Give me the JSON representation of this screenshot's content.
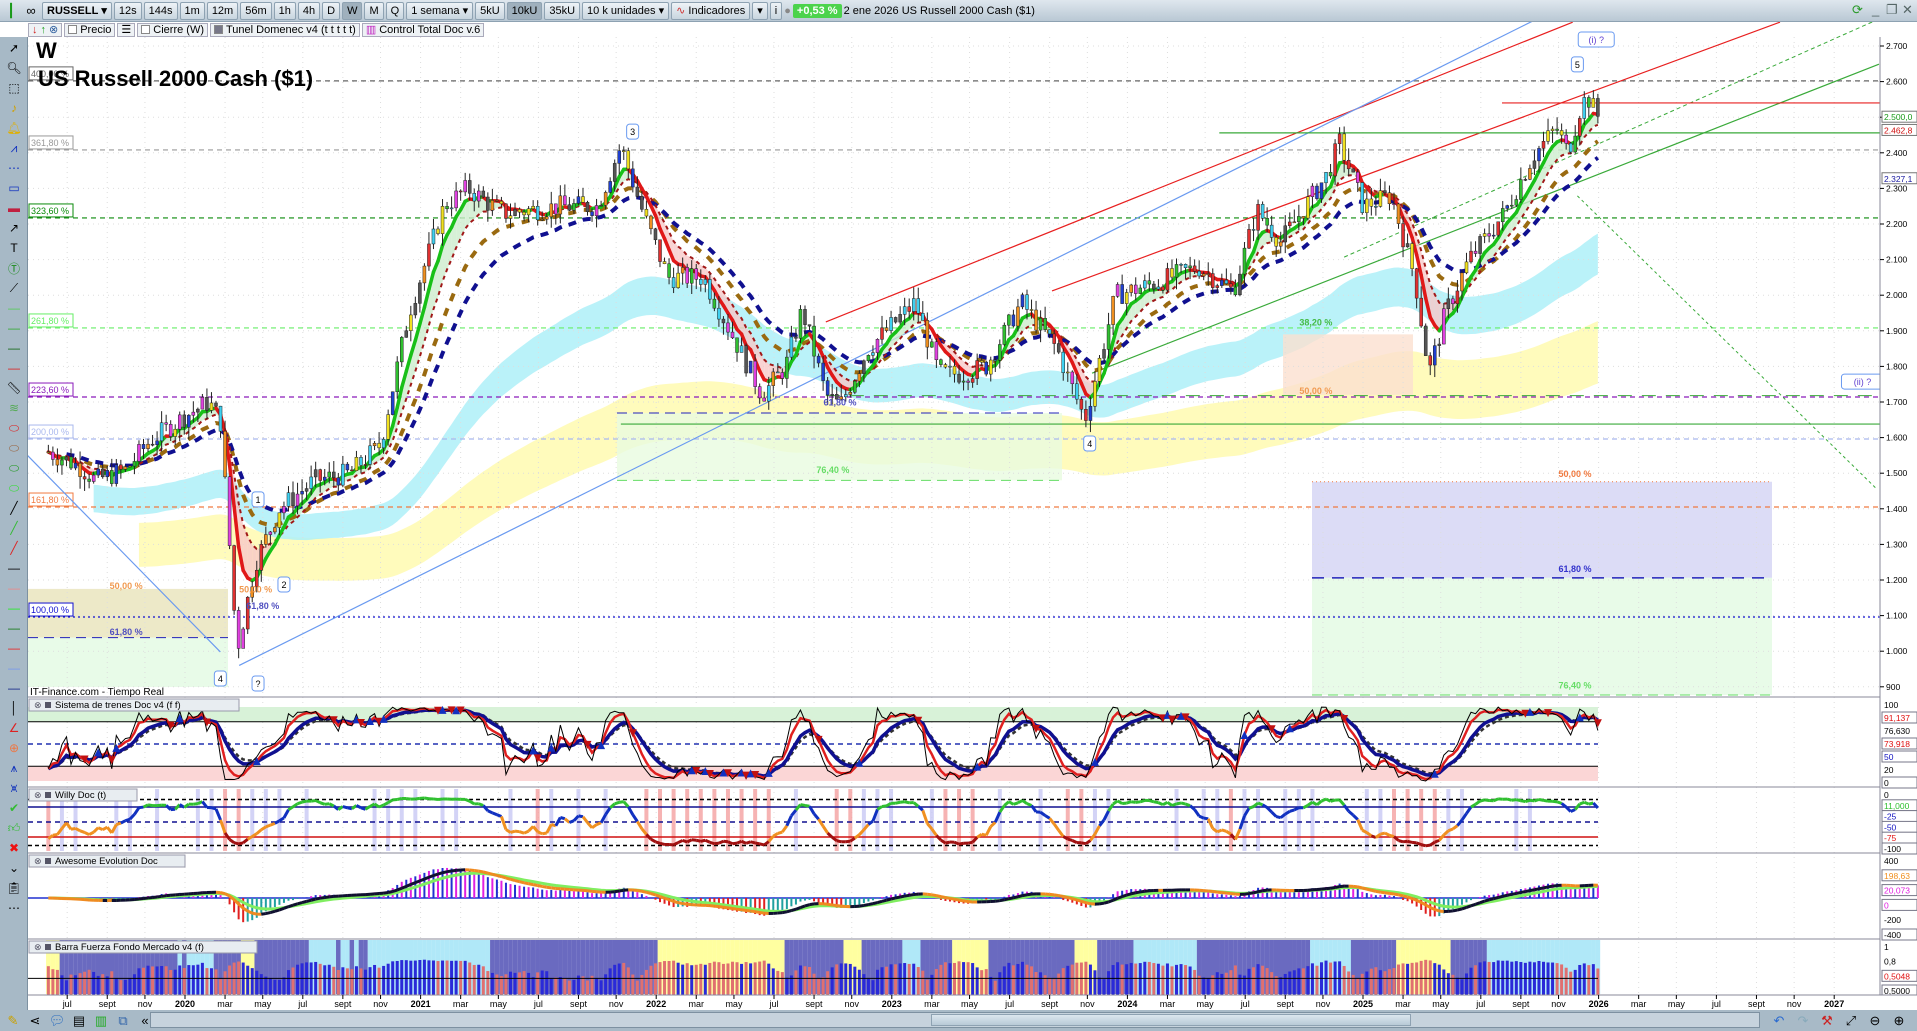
{
  "toolbar": {
    "symbol": "RUSSELL",
    "timeframes": [
      "12s",
      "144s",
      "1m",
      "12m",
      "56m",
      "1h",
      "4h",
      "D",
      "W",
      "M",
      "Q"
    ],
    "active_timeframe": "W",
    "period": "1 semana",
    "units": [
      "5kU",
      "10kU",
      "35kU"
    ],
    "active_unit": "10kU",
    "units_select": "10 k unidades",
    "indicators_label": "Indicadores",
    "change": "+0,53 %",
    "title_info": "2 ene 2026 US Russell 2000 Cash ($1)"
  },
  "legend": {
    "items": [
      "Precio",
      "Cierre (W)",
      "Tunel Domenec v4 (t t t t t)",
      "Control Total Doc v.6"
    ]
  },
  "chart": {
    "period_letter": "W",
    "title": "US Russell 2000 Cash ($1)",
    "source": "IT-Finance.com - Tiempo Real",
    "price_ticks": [
      "2.700",
      "2.600",
      "2.500",
      "2.400",
      "2.300",
      "2.200",
      "2.100",
      "2.000",
      "1.900",
      "1.800",
      "1.700",
      "1.600",
      "1.500",
      "1.400",
      "1.300",
      "1.200",
      "1.100",
      "1.000",
      "900"
    ],
    "price_tick_values": [
      2700,
      2600,
      2500,
      2400,
      2300,
      2200,
      2100,
      2000,
      1900,
      1800,
      1700,
      1600,
      1500,
      1400,
      1300,
      1200,
      1100,
      1000,
      900
    ],
    "price_markers": [
      {
        "label": "2.500,0",
        "price": 2500,
        "color": "#1a9a1a"
      },
      {
        "label": "2.462,8",
        "price": 2462.8,
        "color": "#d01010"
      },
      {
        "label": "2.327,1",
        "price": 2327.1,
        "color": "#1a1aa0"
      }
    ],
    "fib_levels": [
      {
        "label": "400,00 %",
        "price": 2602,
        "color": "#666666"
      },
      {
        "label": "361,80 %",
        "price": 2408,
        "color": "#999999"
      },
      {
        "label": "323,60 %",
        "price": 2217,
        "color": "#0a8a0a"
      },
      {
        "label": "261,80 %",
        "price": 1908,
        "color": "#66ee66"
      },
      {
        "label": "223,60 %",
        "price": 1714,
        "color": "#8a1aba"
      },
      {
        "label": "200,00 %",
        "price": 1596,
        "color": "#a9b8ee"
      },
      {
        "label": "161,80 %",
        "price": 1405,
        "color": "#f07a40"
      },
      {
        "label": "100,00 %",
        "price": 1096,
        "color": "#1010d0"
      }
    ],
    "retracement_labels": [
      {
        "label": "50,00 %",
        "t": 2019.75,
        "price": 1175,
        "color": "#f09a50"
      },
      {
        "label": "61,80 %",
        "t": 2019.75,
        "price": 1045,
        "color": "#5050c0"
      },
      {
        "label": "50,00 %",
        "t": 2020.3,
        "price": 1165,
        "color": "#f09a50"
      },
      {
        "label": "61,80 %",
        "t": 2020.33,
        "price": 1118,
        "color": "#5050c0"
      },
      {
        "label": "61,80 %",
        "t": 2022.78,
        "price": 1690,
        "color": "#5050c0"
      },
      {
        "label": "76,40 %",
        "t": 2022.75,
        "price": 1500,
        "color": "#66dd66"
      },
      {
        "label": "38,20 %",
        "t": 2024.8,
        "price": 1915,
        "color": "#44bb44"
      },
      {
        "label": "50,00 %",
        "t": 2024.8,
        "price": 1722,
        "color": "#f09a50"
      },
      {
        "label": "50,00 %",
        "t": 2025.9,
        "price": 1490,
        "color": "#f07a40"
      },
      {
        "label": "61,80 %",
        "t": 2025.9,
        "price": 1222,
        "color": "#3333cc"
      },
      {
        "label": "76,40 %",
        "t": 2025.9,
        "price": 895,
        "color": "#66dd66"
      }
    ],
    "wave_labels": [
      {
        "text": "1",
        "t": 2020.31,
        "price": 1425
      },
      {
        "text": "2",
        "t": 2020.42,
        "price": 1186
      },
      {
        "text": "3",
        "t": 2021.9,
        "price": 2458
      },
      {
        "text": "4",
        "t": 2020.15,
        "price": 922
      },
      {
        "text": "?",
        "t": 2020.31,
        "price": 908
      },
      {
        "text": "4",
        "t": 2023.84,
        "price": 1582
      },
      {
        "text": "5",
        "t": 2025.91,
        "price": 2647
      },
      {
        "text": "(i) ?",
        "t": 2025.99,
        "price": 2717
      },
      {
        "text": "(ii) ?",
        "t": 2027.12,
        "price": 1756
      }
    ],
    "date_labels": [
      "jul",
      "sept",
      "nov",
      "2020",
      "mar",
      "may",
      "jul",
      "sept",
      "nov",
      "2021",
      "mar",
      "may",
      "jul",
      "sept",
      "nov",
      "2022",
      "mar",
      "may",
      "jul",
      "sept",
      "nov",
      "2023",
      "mar",
      "may",
      "jul",
      "sept",
      "nov",
      "2024",
      "mar",
      "may",
      "jul",
      "sept",
      "nov",
      "2025",
      "mar",
      "may",
      "jul",
      "sept",
      "nov",
      "2026",
      "mar",
      "may",
      "jul",
      "sept",
      "nov",
      "2027"
    ],
    "date_label_times": [
      2019.5,
      2019.67,
      2019.83,
      2020,
      2020.17,
      2020.33,
      2020.5,
      2020.67,
      2020.83,
      2021,
      2021.17,
      2021.33,
      2021.5,
      2021.67,
      2021.83,
      2022,
      2022.17,
      2022.33,
      2022.5,
      2022.67,
      2022.83,
      2023,
      2023.17,
      2023.33,
      2023.5,
      2023.67,
      2023.83,
      2024,
      2024.17,
      2024.33,
      2024.5,
      2024.67,
      2024.83,
      2025,
      2025.17,
      2025.33,
      2025.5,
      2025.67,
      2025.83,
      2026,
      2026.17,
      2026.33,
      2026.5,
      2026.67,
      2026.83,
      2027
    ],
    "price_path": [
      [
        2019.42,
        1560
      ],
      [
        2019.55,
        1520
      ],
      [
        2019.62,
        1480
      ],
      [
        2019.75,
        1510
      ],
      [
        2019.85,
        1590
      ],
      [
        2020.0,
        1660
      ],
      [
        2020.1,
        1700
      ],
      [
        2020.15,
        1650
      ],
      [
        2020.2,
        1200
      ],
      [
        2020.22,
        1000
      ],
      [
        2020.3,
        1250
      ],
      [
        2020.4,
        1400
      ],
      [
        2020.55,
        1480
      ],
      [
        2020.7,
        1500
      ],
      [
        2020.83,
        1580
      ],
      [
        2020.95,
        1950
      ],
      [
        2021.1,
        2250
      ],
      [
        2021.2,
        2300
      ],
      [
        2021.35,
        2230
      ],
      [
        2021.6,
        2250
      ],
      [
        2021.75,
        2250
      ],
      [
        2021.85,
        2420
      ],
      [
        2021.95,
        2220
      ],
      [
        2022.05,
        2050
      ],
      [
        2022.2,
        2050
      ],
      [
        2022.45,
        1720
      ],
      [
        2022.55,
        1800
      ],
      [
        2022.62,
        1960
      ],
      [
        2022.72,
        1720
      ],
      [
        2022.78,
        1690
      ],
      [
        2022.9,
        1850
      ],
      [
        2023.1,
        1980
      ],
      [
        2023.2,
        1780
      ],
      [
        2023.3,
        1780
      ],
      [
        2023.4,
        1800
      ],
      [
        2023.55,
        1980
      ],
      [
        2023.7,
        1850
      ],
      [
        2023.82,
        1650
      ],
      [
        2023.95,
        2000
      ],
      [
        2024.1,
        2030
      ],
      [
        2024.3,
        2080
      ],
      [
        2024.45,
        2010
      ],
      [
        2024.55,
        2240
      ],
      [
        2024.65,
        2150
      ],
      [
        2024.85,
        2340
      ],
      [
        2024.9,
        2430
      ],
      [
        2025.0,
        2250
      ],
      [
        2025.12,
        2280
      ],
      [
        2025.22,
        2050
      ],
      [
        2025.28,
        1780
      ],
      [
        2025.35,
        1950
      ],
      [
        2025.45,
        2100
      ],
      [
        2025.6,
        2230
      ],
      [
        2025.72,
        2390
      ],
      [
        2025.82,
        2470
      ],
      [
        2025.87,
        2400
      ],
      [
        2025.92,
        2520
      ],
      [
        2025.95,
        2560
      ],
      [
        2026.0,
        2500
      ]
    ],
    "colors": {
      "bull": "#18c018",
      "bear": "#e01818",
      "blue_ma": "#101090",
      "brown_ma": "#9a6a10",
      "cyan_band": "#aef0f8",
      "yellow_band": "#fffab0"
    }
  },
  "panels": [
    {
      "title": "Sistema de trenes Doc v4 (f f)",
      "ticks": [
        "100",
        "91,137",
        "76,630",
        "73,918",
        "50",
        "20",
        "0"
      ]
    },
    {
      "title": "Willy Doc (t)",
      "ticks": [
        "0",
        "11,000",
        "-25",
        "-50",
        "-75",
        "-100"
      ]
    },
    {
      "title": "Awesome Evolution Doc",
      "ticks": [
        "400",
        "198,63",
        "20,073",
        "0",
        "-200",
        "-400"
      ]
    },
    {
      "title": "Barra Fuerza Fondo Mercado v4 (f)",
      "ticks": [
        "1",
        "0,8",
        "0,5048",
        "0,5000"
      ]
    }
  ]
}
